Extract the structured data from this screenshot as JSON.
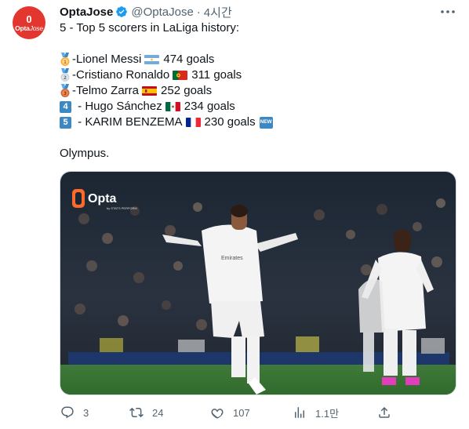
{
  "author": {
    "avatar_glyph": "0",
    "avatar_brand_bold": "Opta",
    "avatar_brand_light": "Jose",
    "display_name": "OptaJose",
    "handle": "@OptaJose",
    "separator": "·",
    "timestamp": "4시간",
    "verified_icon": "verified-badge-icon",
    "accent_color": "#e2362f"
  },
  "tweet": {
    "headline": "5 - Top 5 scorers in LaLiga history:",
    "scorers": [
      {
        "rank_icon": "gold-medal-icon",
        "prefix": "- ",
        "name": "Lionel Messi",
        "flag": "argentina-flag-icon",
        "goals": "474 goals"
      },
      {
        "rank_icon": "silver-medal-icon",
        "prefix": "- ",
        "name": "Cristiano Ronaldo",
        "flag": "portugal-flag-icon",
        "goals": "311 goals"
      },
      {
        "rank_icon": "bronze-medal-icon",
        "prefix": "- ",
        "name": "Telmo Zarra",
        "flag": "spain-flag-icon",
        "goals": "252 goals"
      },
      {
        "rank_icon": "keycap-4-icon",
        "rank_text": "4",
        "prefix": " - ",
        "name": "Hugo Sánchez",
        "flag": "mexico-flag-icon",
        "goals": "234 goals"
      },
      {
        "rank_icon": "keycap-5-icon",
        "rank_text": "5",
        "prefix": " - ",
        "name": "KARIM BENZEMA",
        "flag": "france-flag-icon",
        "goals": "230 goals",
        "badge": "NEW"
      }
    ],
    "closing": "Olympus."
  },
  "media": {
    "watermark_logo": "Opta",
    "watermark_sub": "by STATS PERFORM",
    "shirt_sponsor": "Emirates"
  },
  "actions": {
    "reply_count": "3",
    "retweet_count": "24",
    "like_count": "107",
    "views_count": "1.1만"
  }
}
